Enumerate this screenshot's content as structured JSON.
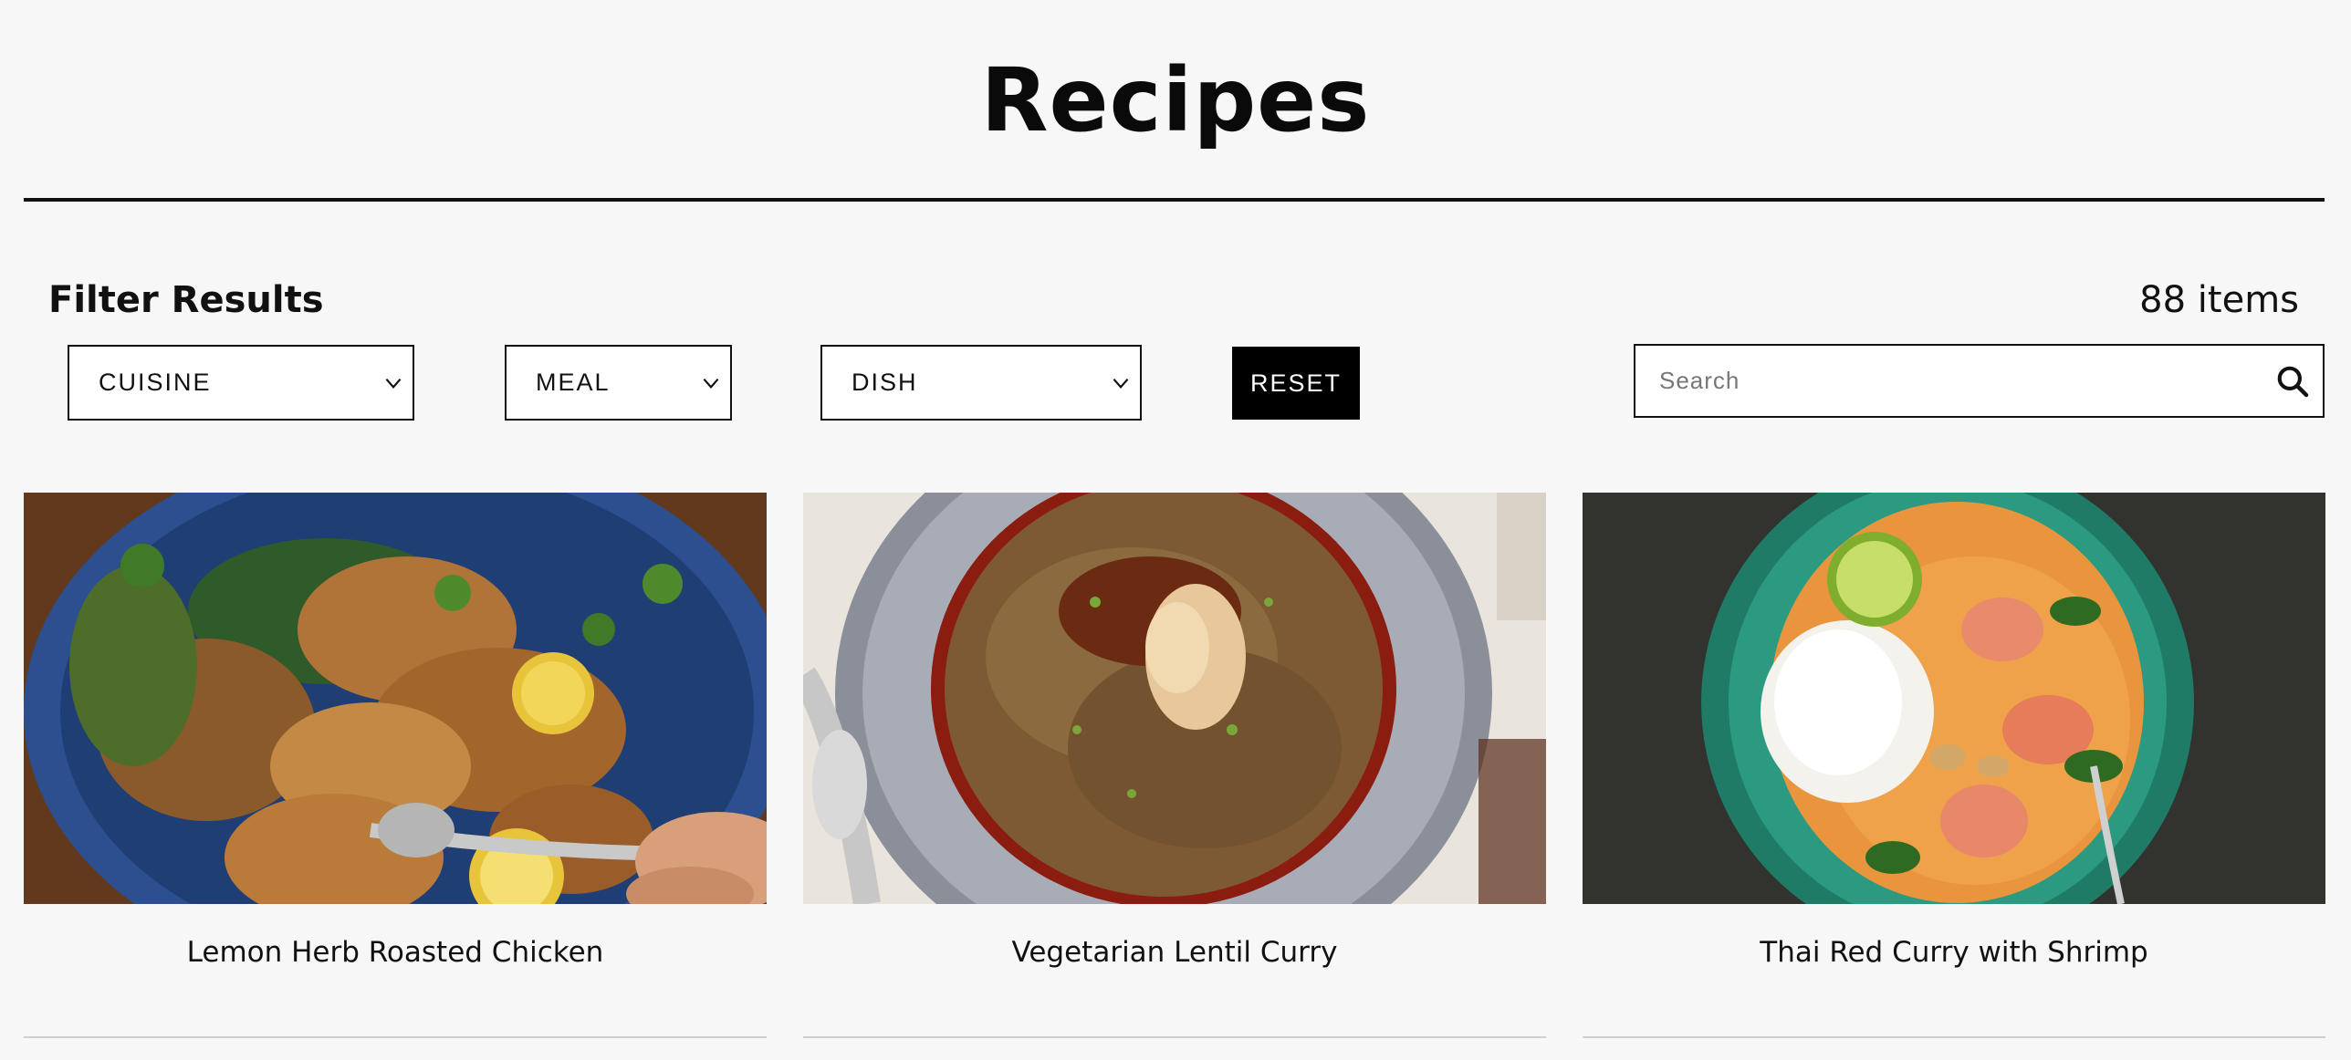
{
  "page": {
    "title": "Recipes"
  },
  "filters": {
    "heading": "Filter Results",
    "item_count": "88 items",
    "cuisine_label": "CUISINE",
    "meal_label": "MEAL",
    "dish_label": "DISH",
    "reset_label": "RESET"
  },
  "search": {
    "placeholder": "Search",
    "value": ""
  },
  "recipes": [
    {
      "title": "Lemon Herb Roasted Chicken",
      "image_icon": "roast-chicken-photo"
    },
    {
      "title": "Vegetarian Lentil Curry",
      "image_icon": "lentil-curry-photo"
    },
    {
      "title": "Thai Red Curry with Shrimp",
      "image_icon": "thai-curry-photo"
    }
  ],
  "colors": {
    "background": "#f7f7f7",
    "text": "#111111",
    "button_bg": "#000000",
    "button_text": "#ffffff",
    "divider": "#cfcfcf"
  }
}
